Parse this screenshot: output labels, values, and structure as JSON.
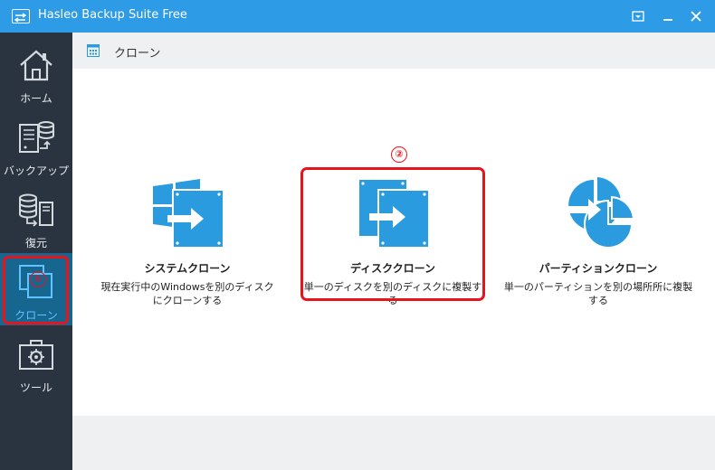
{
  "window": {
    "title": "Hasleo Backup Suite Free"
  },
  "sidebar": {
    "items": [
      {
        "label": "ホーム",
        "icon": "home-icon"
      },
      {
        "label": "バックアップ",
        "icon": "backup-icon"
      },
      {
        "label": "復元",
        "icon": "restore-icon"
      },
      {
        "label": "クローン",
        "icon": "clone-icon",
        "active": true
      },
      {
        "label": "ツール",
        "icon": "tools-icon"
      }
    ],
    "marker": "①"
  },
  "header": {
    "title": "クローン",
    "icon": "grid-icon"
  },
  "cards": [
    {
      "title": "システムクローン",
      "desc": "現在実行中のWindowsを別のディスクにクローンする",
      "icon": "system-clone-icon"
    },
    {
      "title": "ディスククローン",
      "desc": "単一のディスクを別のディスクに複製する",
      "icon": "disk-clone-icon"
    },
    {
      "title": "パーティションクローン",
      "desc": "単一のパーティションを別の場所所に複製する",
      "icon": "partition-clone-icon"
    }
  ],
  "annotation_marker": "②",
  "colors": {
    "titlebar": "#2e9be6",
    "sidebar": "#2a3440",
    "active": "#16668f",
    "accent": "#2b9be0",
    "highlight": "#e8141b"
  }
}
